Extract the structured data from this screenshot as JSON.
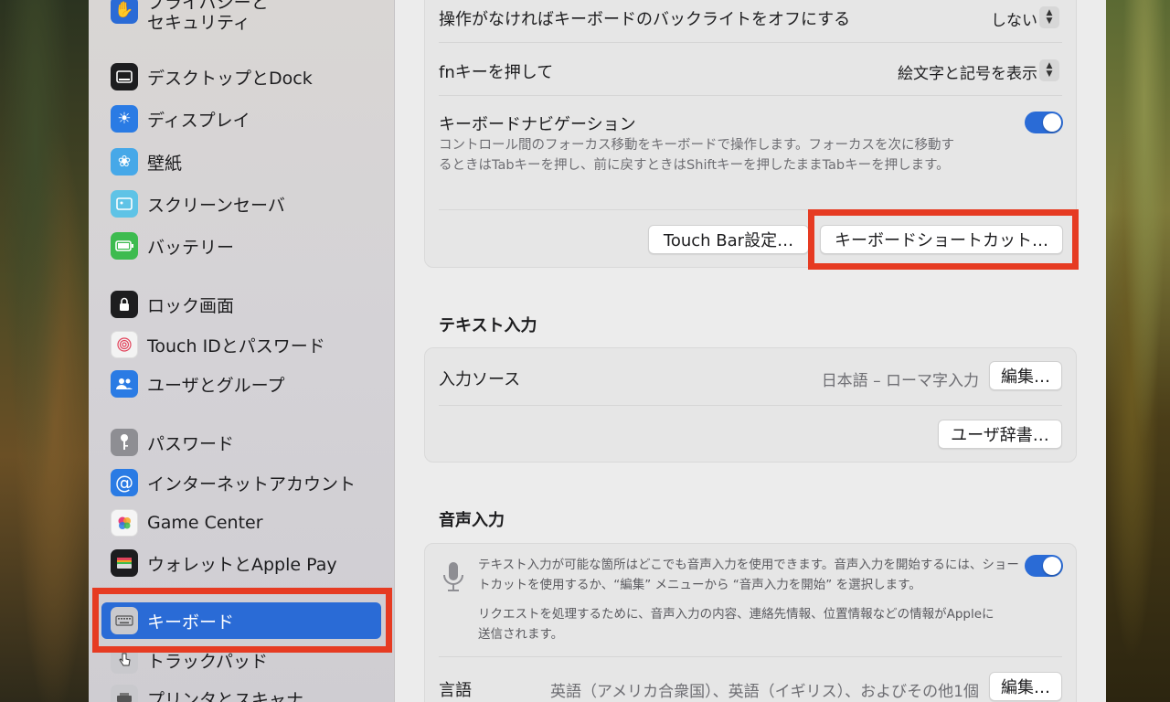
{
  "sidebar": {
    "items": [
      {
        "label": "プライバシーと\nセキュリティ",
        "icon": "hand-icon",
        "color": "#2a6bd6"
      },
      {
        "label": "デスクトップとDock",
        "icon": "dock-icon",
        "color": "#1d1d1f"
      },
      {
        "label": "ディスプレイ",
        "icon": "sun-icon",
        "color": "#2a7be4"
      },
      {
        "label": "壁紙",
        "icon": "flower-icon",
        "color": "#46a8e8"
      },
      {
        "label": "スクリーンセーバ",
        "icon": "screensaver-icon",
        "color": "#5fc3e6"
      },
      {
        "label": "バッテリー",
        "icon": "battery-icon",
        "color": "#3dbb4f"
      },
      {
        "label": "ロック画面",
        "icon": "lock-icon",
        "color": "#1d1d1f"
      },
      {
        "label": "Touch IDとパスワード",
        "icon": "fingerprint-icon",
        "color": "#f3f3f3"
      },
      {
        "label": "ユーザとグループ",
        "icon": "users-icon",
        "color": "#2a7be4"
      },
      {
        "label": "パスワード",
        "icon": "key-icon",
        "color": "#8e8e93"
      },
      {
        "label": "インターネットアカウント",
        "icon": "at-icon",
        "color": "#2a7be4"
      },
      {
        "label": "Game Center",
        "icon": "game-center-icon",
        "color": "#f5f5f5"
      },
      {
        "label": "ウォレットとApple Pay",
        "icon": "wallet-icon",
        "color": "#1d1d1f"
      },
      {
        "label": "キーボード",
        "icon": "keyboard-icon",
        "color": "#9a9aa0"
      },
      {
        "label": "トラックパッド",
        "icon": "trackpad-icon",
        "color": "#9a9aa0"
      },
      {
        "label": "プリンタとスキャナ",
        "icon": "printer-icon",
        "color": "#9a9aa0"
      }
    ],
    "selected": "キーボード"
  },
  "keyboard": {
    "backlight_label": "操作がなければキーボードのバックライトをオフにする",
    "backlight_value": "しない",
    "fn_label": "fnキーを押して",
    "fn_value": "絵文字と記号を表示",
    "nav_label": "キーボードナビゲーション",
    "nav_desc": "コントロール間のフォーカス移動をキーボードで操作します。フォーカスを次に移動するときはTabキーを押し、前に戻すときはShiftキーを押したままTabキーを押します。",
    "nav_enabled": true,
    "touchbar_button": "Touch Bar設定…",
    "shortcuts_button": "キーボードショートカット…"
  },
  "text_input": {
    "title": "テキスト入力",
    "source_label": "入力ソース",
    "source_value": "日本語 – ローマ字入力",
    "edit_button": "編集…",
    "user_dict_button": "ユーザ辞書…"
  },
  "dictation": {
    "title": "音声入力",
    "desc1": "テキスト入力が可能な箇所はどこでも音声入力を使用できます。音声入力を開始するには、ショートカットを使用するか、“編集” メニューから “音声入力を開始” を選択します。",
    "desc2": "リクエストを処理するために、音声入力の内容、連絡先情報、位置情報などの情報がAppleに送信されます。",
    "enabled": true,
    "language_label": "言語",
    "language_value": "英語（アメリカ合衆国）、英語（イギリス）、およびその他1個",
    "edit_button": "編集…"
  },
  "colors": {
    "accent": "#2a6bd6",
    "highlight_box": "#e63b22"
  }
}
